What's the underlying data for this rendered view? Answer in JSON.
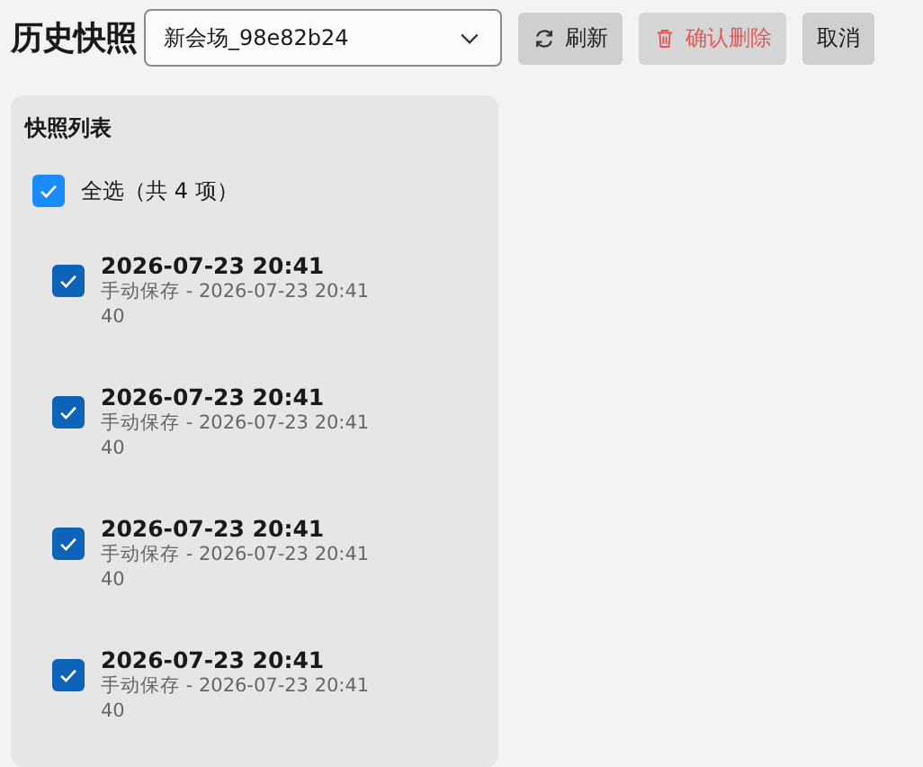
{
  "header": {
    "title": "历史快照",
    "session_select": {
      "value": "新会场_98e82b24"
    },
    "buttons": [
      {
        "kind": "refresh",
        "label": "刷新",
        "disabled": false
      },
      {
        "kind": "delete",
        "label": "确认删除",
        "disabled": false
      },
      {
        "kind": "cancel",
        "label": "取消",
        "disabled": false
      }
    ]
  },
  "panel": {
    "title": "快照列表",
    "select_all": {
      "label": "全选（共 4 项）",
      "checked": true
    },
    "snapshots": [
      {
        "title": "2026-07-23 20:41",
        "subtitle": "手动保存 - 2026-07-23 20:41 40",
        "checked": true
      },
      {
        "title": "2026-07-23 20:41",
        "subtitle": "手动保存 - 2026-07-23 20:41 40",
        "checked": true
      },
      {
        "title": "2026-07-23 20:41",
        "subtitle": "手动保存 - 2026-07-23 20:41 40",
        "checked": true
      },
      {
        "title": "2026-07-23 20:41",
        "subtitle": "手动保存 - 2026-07-23 20:41 40",
        "checked": true
      }
    ]
  }
}
